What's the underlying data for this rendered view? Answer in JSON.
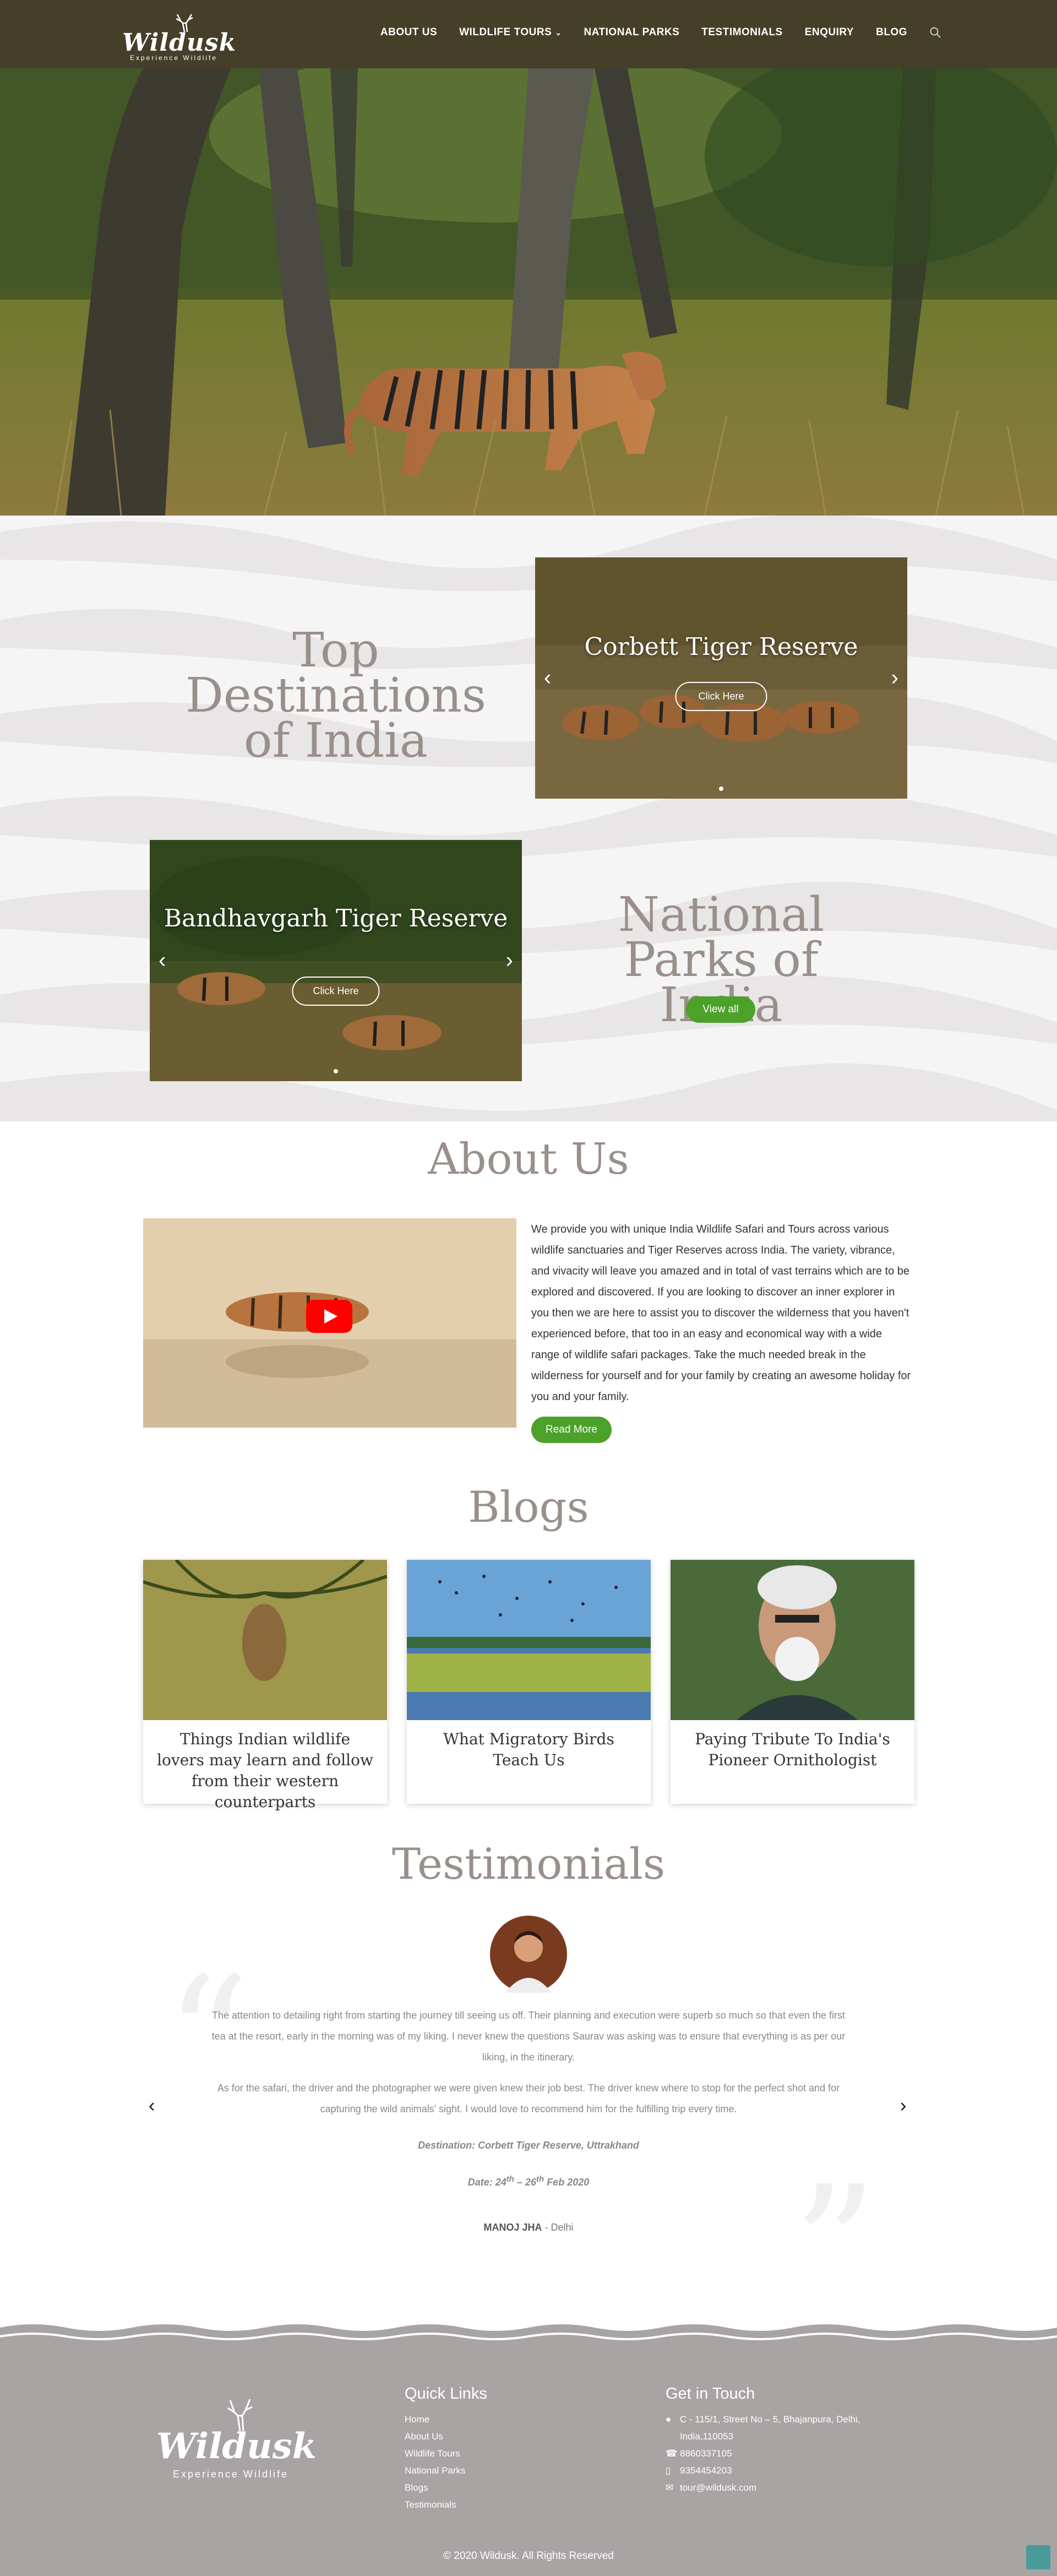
{
  "header": {
    "brand": "Wildusk",
    "tagline": "Experience Wildlife",
    "nav": [
      {
        "label": "ABOUT US"
      },
      {
        "label": "WILDLIFE TOURS"
      },
      {
        "label": "NATIONAL PARKS"
      },
      {
        "label": "TESTIMONIALS"
      },
      {
        "label": "ENQUIRY"
      },
      {
        "label": "BLOG"
      }
    ]
  },
  "destinations": {
    "title": "Top Destinations of India",
    "slide_title": "Corbett Tiger Reserve",
    "slide_button": "Click Here"
  },
  "parks": {
    "title": "National Parks of India",
    "slide_title": "Bandhavgarh Tiger Reserve",
    "slide_button": "Click Here",
    "view_all": "View all"
  },
  "about": {
    "title": "About Us",
    "text": "We provide you with unique India Wildlife Safari  and Tours across various wildlife sanctuaries and Tiger Reserves across India. The variety, vibrance, and vivacity will leave you amazed and in total of vast terrains which are to be explored and discovered. If you are looking to discover an inner explorer in you then we are here to assist you to discover the wilderness that you haven't experienced before, that too in an easy and economical way  with a wide range of wildlife safari packages. Take the much needed break in the wilderness for yourself and for your family by creating an awesome holiday for you and your family.",
    "read_more": "Read More"
  },
  "blogs": {
    "title": "Blogs",
    "items": [
      {
        "title": "Things Indian wildlife lovers may learn and follow from their western counterparts"
      },
      {
        "title": "What Migratory Birds Teach Us"
      },
      {
        "title": "Paying Tribute To India's Pioneer Ornithologist"
      }
    ]
  },
  "testimonials": {
    "title": "Testimonials",
    "para1": "The attention to detailing right from starting the journey till seeing us off. Their planning and execution were superb so much so that even the first tea at the resort, early in the morning was of my liking. I never knew the questions Saurav was asking was to ensure that everything is as per our liking, in the itinerary.",
    "para2": "As for the safari, the driver and the photographer we were given knew their job best. The driver knew where to stop for the perfect shot and for capturing the wild animals' sight. I would love to recommend him for the fulfilling trip every time.",
    "destination": "Destination: Corbett Tiger Reserve, Uttrakhand",
    "date_prefix": "Date: 24",
    "date_sup1": "th",
    "date_mid": " – 26",
    "date_sup2": "th",
    "date_suffix": " Feb 2020",
    "author": "MANOJ JHA",
    "location": " - Delhi"
  },
  "footer": {
    "quick_links_title": "Quick Links",
    "quick_links": [
      "Home",
      "About Us",
      "Wildlife Tours",
      "National Parks",
      "Blogs",
      "Testimonials"
    ],
    "contact_title": "Get in Touch",
    "address": "C - 115/1, Street No – 5, Bhajanpura, Delhi, India,110053",
    "phone1": "8860337105",
    "phone2": "9354454203",
    "email": "tour@wildusk.com",
    "copyright": "© 2020 Wildusk. All Rights Reserved"
  }
}
